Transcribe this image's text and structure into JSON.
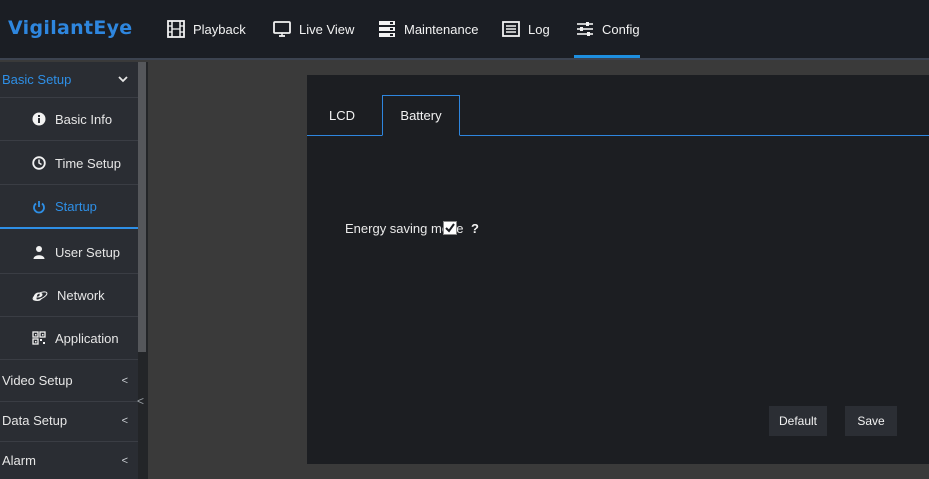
{
  "brand": {
    "logo_text": "VigilantEye",
    "accent": "#2e86de"
  },
  "nav": [
    {
      "label": "Playback",
      "icon": "film-icon"
    },
    {
      "label": "Live View",
      "icon": "monitor-icon"
    },
    {
      "label": "Maintenance",
      "icon": "server-icon"
    },
    {
      "label": "Log",
      "icon": "list-icon"
    },
    {
      "label": "Config",
      "icon": "sliders-icon",
      "active": true
    }
  ],
  "sidebar": {
    "basic_setup": {
      "label": "Basic Setup",
      "chevron": "⌄"
    },
    "items": [
      {
        "label": "Basic Info",
        "icon": "info-icon"
      },
      {
        "label": "Time Setup",
        "icon": "clock-icon"
      },
      {
        "label": "Startup",
        "icon": "power-icon",
        "active": true
      },
      {
        "label": "User Setup",
        "icon": "user-icon"
      },
      {
        "label": "Network",
        "icon": "globe-icon"
      },
      {
        "label": "Application",
        "icon": "qr-icon"
      }
    ],
    "groups": [
      {
        "label": "Video Setup",
        "chevron": "<"
      },
      {
        "label": "Data Setup",
        "chevron": "<"
      },
      {
        "label": "Alarm",
        "chevron": "<"
      }
    ],
    "collapse_arrow": "<"
  },
  "panel": {
    "tabs": [
      {
        "label": "LCD"
      },
      {
        "label": "Battery",
        "active": true
      }
    ],
    "energy_saving": {
      "label": "Energy saving mode",
      "checked": true,
      "help": "?"
    },
    "buttons": {
      "default_label": "Default",
      "save_label": "Save"
    }
  }
}
